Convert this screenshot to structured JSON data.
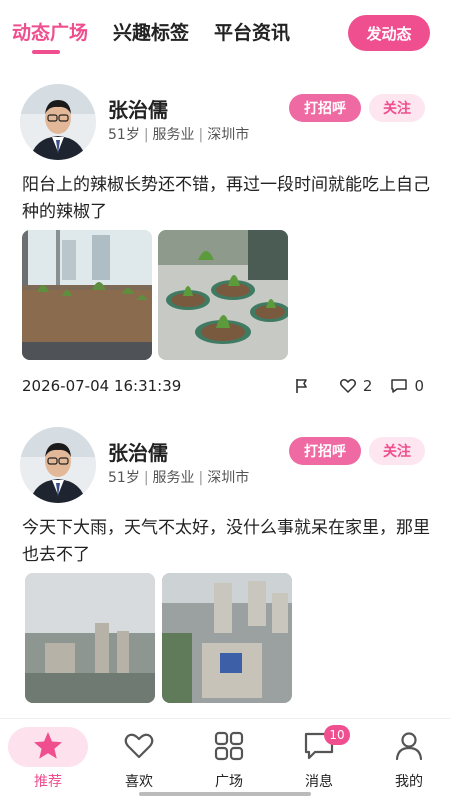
{
  "header": {
    "tabs": [
      {
        "label": "动态广场",
        "active": true
      },
      {
        "label": "兴趣标签",
        "active": false
      },
      {
        "label": "平台资讯",
        "active": false
      }
    ],
    "post_button": "发动态"
  },
  "feed": [
    {
      "user": {
        "name": "张治儒",
        "age": "51岁",
        "industry": "服务业",
        "city": "深圳市"
      },
      "greet_label": "打招呼",
      "follow_label": "关注",
      "text": "阳台上的辣椒长势还不错，再过一段时间就能吃上自己种的辣椒了",
      "images": [
        "balcony-planter-image",
        "potted-pepper-image"
      ],
      "time": "2026-07-04 16:31:39",
      "likes": "2",
      "comments": "0"
    },
    {
      "user": {
        "name": "张治儒",
        "age": "51岁",
        "industry": "服务业",
        "city": "深圳市"
      },
      "greet_label": "打招呼",
      "follow_label": "关注",
      "text": "今天下大雨，天气不太好，没什么事就呆在家里，那里也去不了",
      "images": [
        "rainy-city-image",
        "city-aerial-image"
      ]
    }
  ],
  "bottom_nav": [
    {
      "label": "推荐",
      "icon": "star-icon",
      "active": true
    },
    {
      "label": "喜欢",
      "icon": "heart-icon",
      "active": false
    },
    {
      "label": "广场",
      "icon": "grid-icon",
      "active": false
    },
    {
      "label": "消息",
      "icon": "message-icon",
      "active": false,
      "badge": "10"
    },
    {
      "label": "我的",
      "icon": "person-icon",
      "active": false
    }
  ],
  "colors": {
    "accent": "#ef4f8f",
    "accent_light": "#fde6ef"
  }
}
